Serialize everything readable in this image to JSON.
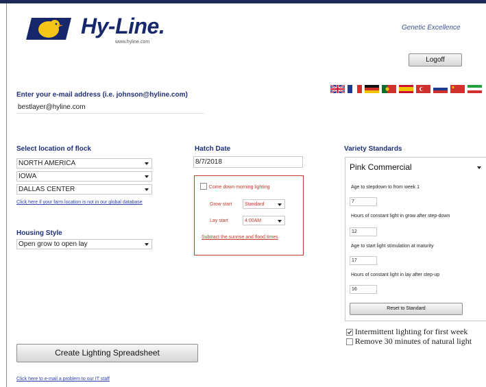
{
  "brand": {
    "name": "Hy-Line.",
    "url": "www.hyline.com",
    "tagline": "Genetic Excellence"
  },
  "header": {
    "logoff_label": "Logoff"
  },
  "email": {
    "label": "Enter your e-mail address (i.e. johnson@hyline.com)",
    "value": "bestlayer@hyline.com"
  },
  "flags": [
    "flag-uk-icon",
    "flag-france-icon",
    "flag-germany-icon",
    "flag-portugal-icon",
    "flag-spain-icon",
    "flag-turkey-icon",
    "flag-russia-icon",
    "flag-china-icon",
    "flag-iran-icon"
  ],
  "location": {
    "label": "Select location of flock",
    "region": "NORTH AMERICA",
    "state": "IOWA",
    "city": "DALLAS CENTER",
    "link": "Click here if your farm location is not in our global database"
  },
  "housing": {
    "label": "Housing Style",
    "value": "Open grow to open lay"
  },
  "hatch": {
    "label": "Hatch Date",
    "value": "8/7/2018",
    "morning_label": "Come down morning lighting",
    "grow_start_label": "Grow start",
    "grow_start_value": "Standard",
    "lay_start_label": "Lay start",
    "lay_start_value": "4:00AM",
    "sunrise_link": "Subtract the sunrise and flood times"
  },
  "variety": {
    "label": "Variety Standards",
    "value": "Pink Commercial",
    "q1": "Age to stepdown to from week 1",
    "a1": "7",
    "q2": "Hours of constant light in grow after step-down",
    "a2": "12",
    "q3": "Age to start light stimulation at maturity",
    "a3": "17",
    "q4": "Hours of constant light in lay after step-up",
    "a4": "16",
    "reset_label": "Reset to Standard",
    "intermittent_label": "Intermittent lighting for first week",
    "remove_label": "Remove 30 minutes of natural light"
  },
  "actions": {
    "create_label": "Create Lighting Spreadsheet",
    "problem_link": "Click here to e-mail a problem to our IT staff"
  }
}
